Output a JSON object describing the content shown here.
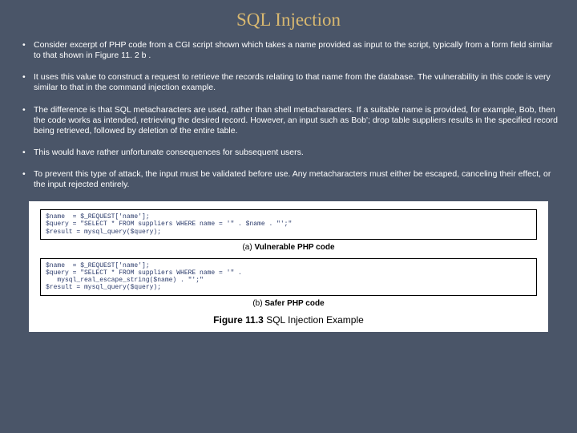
{
  "title": "SQL Injection",
  "bullets": [
    "Consider excerpt of PHP code from a CGI script shown which takes a name provided as input to the script, typically from a form field similar to that shown in Figure 11. 2 b .",
    "It uses this value to construct a request to retrieve the records relating to that name from the database. The vulnerability in this code is very similar to that in the command injection example.",
    "The difference is that SQL metacharacters are used, rather than shell metacharacters. If a suitable name is provided, for example, Bob, then the code works as intended, retrieving the desired record. However, an input such as Bob'; drop table suppliers results in the specified record being retrieved, followed by deletion of the entire table.",
    "This would have rather unfortunate consequences for subsequent users.",
    "To prevent this type of attack, the input must be validated before use. Any metacharacters must either be escaped, canceling their effect, or the input rejected entirely."
  ],
  "code_a": "$name  = $_REQUEST['name'];\n$query = \"SELECT * FROM suppliers WHERE name = '\" . $name . \"';\"\n$result = mysql_query($query);",
  "caption_a_prefix": "(a)",
  "caption_a_text": "Vulnerable PHP code",
  "code_b": "$name  = $_REQUEST['name'];\n$query = \"SELECT * FROM suppliers WHERE name = '\" .\n   mysql_real_escape_string($name) . \"';\"\n$result = mysql_query($query);",
  "caption_b_prefix": "(b)",
  "caption_b_text": "Safer PHP code",
  "figure_label": "Figure 11.3",
  "figure_title": "SQL Injection Example"
}
